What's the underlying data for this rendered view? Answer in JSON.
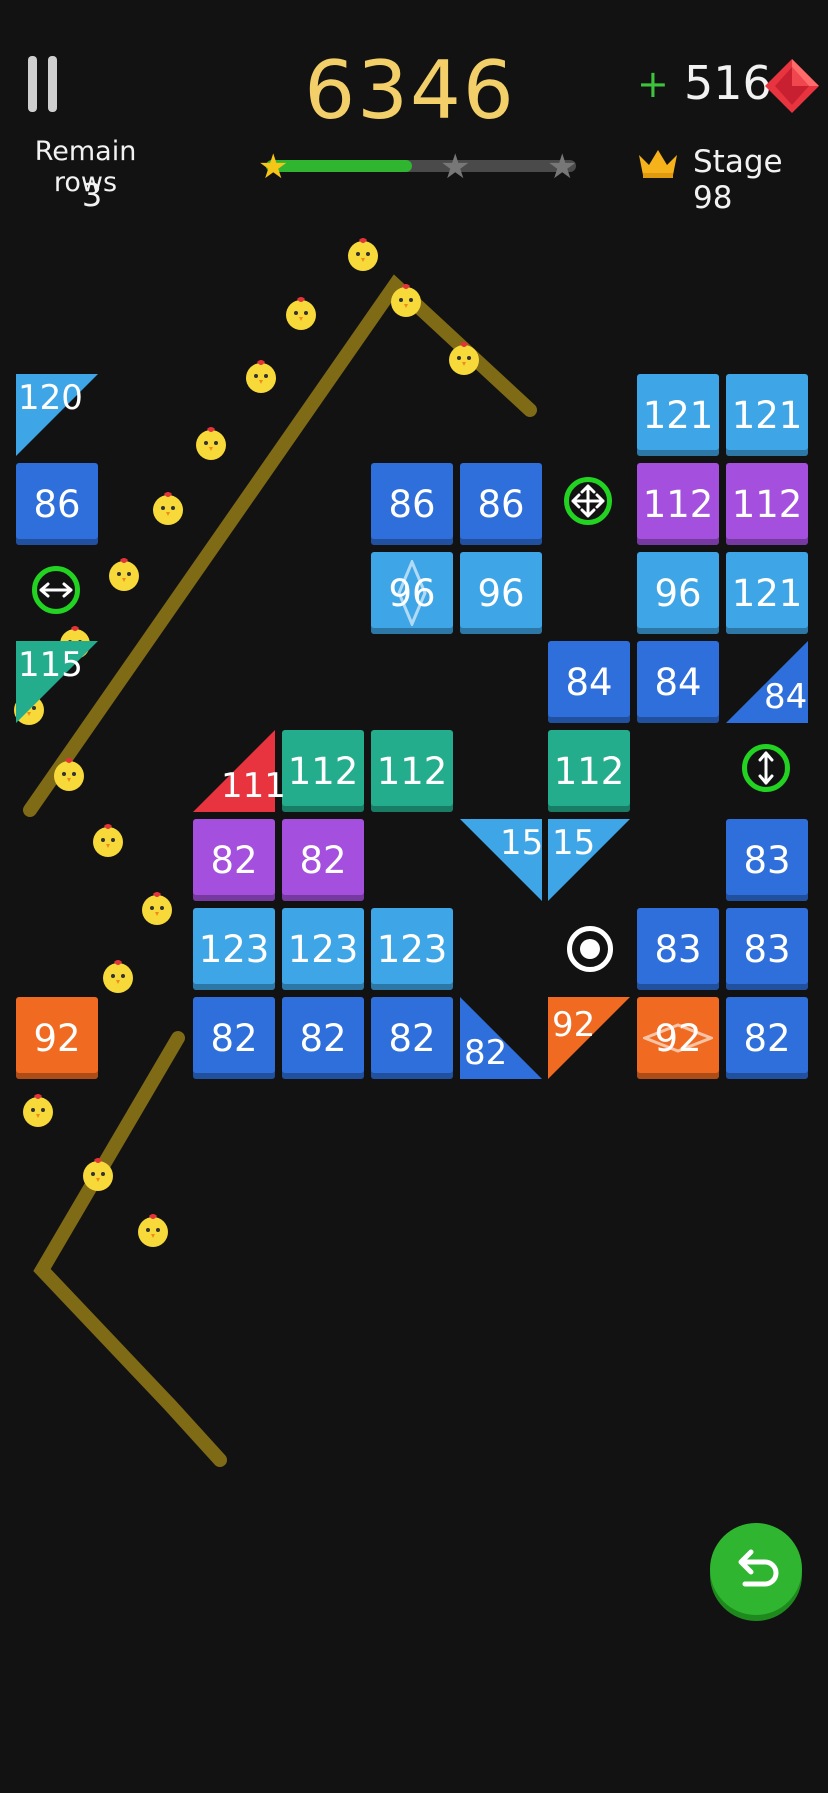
{
  "hud": {
    "pause_icon": "pause-icon",
    "remain_label": "Remain rows",
    "remain_value": "3",
    "score": "6346",
    "progress_fraction": 0.47,
    "stars_earned": 1,
    "stars_total": 3,
    "gem_plus": "+",
    "gem_count": "516",
    "gem_icon": "red-gem-icon",
    "crown_icon": "crown-icon",
    "stage_label": "Stage 98"
  },
  "colors": {
    "blue": "#2f6fdb",
    "light_blue": "#3ea6e6",
    "purple": "#a44fde",
    "teal": "#23ad8c",
    "orange": "#f06a21",
    "red": "#e8343f",
    "accent_green": "#2fb52f",
    "score_gold": "#f3cf6a"
  },
  "bricks": [
    {
      "v": "86",
      "c": "blue"
    },
    {
      "v": "86",
      "c": "blue"
    },
    {
      "v": "86",
      "c": "blue"
    },
    {
      "v": "96",
      "c": "light_blue",
      "icon": "vertical-diamond-icon"
    },
    {
      "v": "96",
      "c": "light_blue"
    },
    {
      "v": "121",
      "c": "light_blue"
    },
    {
      "v": "121",
      "c": "light_blue"
    },
    {
      "v": "112",
      "c": "purple"
    },
    {
      "v": "112",
      "c": "purple"
    },
    {
      "v": "96",
      "c": "light_blue"
    },
    {
      "v": "121",
      "c": "light_blue"
    },
    {
      "v": "84",
      "c": "blue"
    },
    {
      "v": "84",
      "c": "blue"
    },
    {
      "v": "112",
      "c": "teal"
    },
    {
      "v": "112",
      "c": "teal"
    },
    {
      "v": "112",
      "c": "teal"
    },
    {
      "v": "82",
      "c": "purple"
    },
    {
      "v": "82",
      "c": "purple"
    },
    {
      "v": "83",
      "c": "blue"
    },
    {
      "v": "123",
      "c": "light_blue"
    },
    {
      "v": "123",
      "c": "light_blue"
    },
    {
      "v": "123",
      "c": "light_blue"
    },
    {
      "v": "83",
      "c": "blue"
    },
    {
      "v": "83",
      "c": "blue"
    },
    {
      "v": "92",
      "c": "orange"
    },
    {
      "v": "82",
      "c": "blue"
    },
    {
      "v": "82",
      "c": "blue"
    },
    {
      "v": "82",
      "c": "blue"
    },
    {
      "v": "92",
      "c": "orange",
      "icon": "horizontal-diamond-icon"
    },
    {
      "v": "82",
      "c": "blue"
    }
  ],
  "triangles": [
    {
      "v": "120",
      "c": "light_blue"
    },
    {
      "v": "115",
      "c": "teal"
    },
    {
      "v": "84",
      "c": "blue"
    },
    {
      "v": "111",
      "c": "red"
    },
    {
      "v": "15",
      "c": "light_blue"
    },
    {
      "v": "15",
      "c": "light_blue"
    },
    {
      "v": "82",
      "c": "blue"
    },
    {
      "v": "92",
      "c": "orange"
    }
  ],
  "powerups": [
    {
      "icon": "horizontal-arrows-icon"
    },
    {
      "icon": "four-way-arrows-icon"
    },
    {
      "icon": "vertical-arrows-icon"
    }
  ],
  "target_icon": "aim-target-icon",
  "ball_icon": "chick-ball-icon",
  "undo_icon": "undo-arrow-icon"
}
